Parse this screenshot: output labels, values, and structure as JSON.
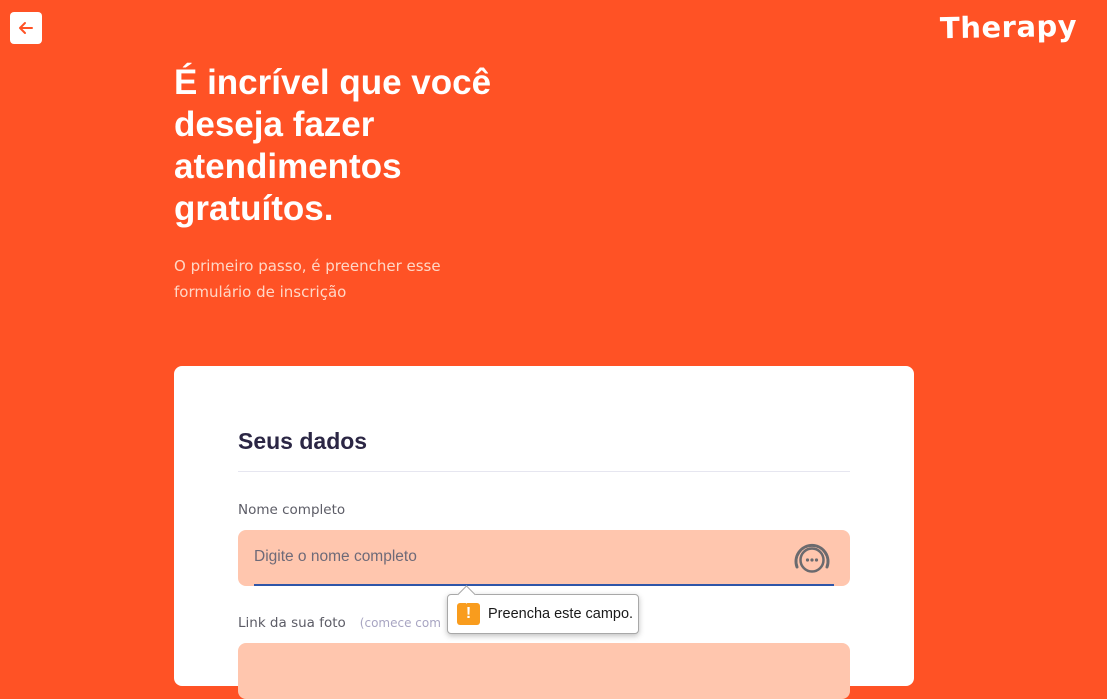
{
  "header": {
    "back_icon": "arrow-left-icon",
    "logo": "Therapy"
  },
  "hero": {
    "title": "É incrível que você deseja fazer atendimentos gratuítos.",
    "subtitle": "O primeiro passo, é preencher esse formulário de inscrição"
  },
  "form": {
    "section_title": "Seus dados",
    "fields": {
      "name": {
        "label": "Nome completo",
        "placeholder": "Digite o nome completo",
        "value": "",
        "icon": "password-manager-icon"
      },
      "photo": {
        "label": "Link da sua foto",
        "hint": "(comece com"
      }
    }
  },
  "validation_tooltip": {
    "icon": "warning-icon",
    "message": "Preencha este campo."
  },
  "colors": {
    "background": "#FF5225",
    "input_background": "#FFC6AE",
    "heading": "#2B2644",
    "warning": "#F99C1D"
  }
}
